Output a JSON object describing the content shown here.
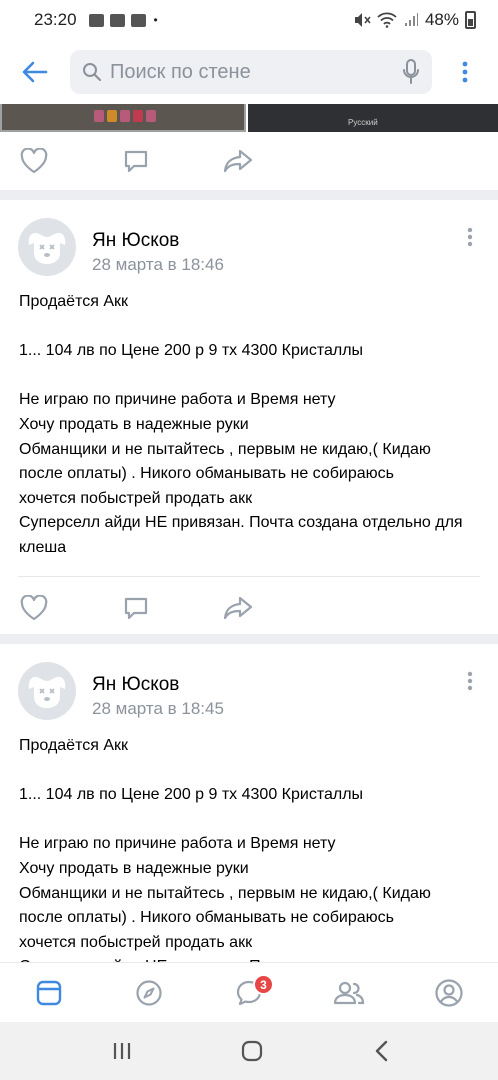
{
  "status_bar": {
    "time": "23:20",
    "dot": "•",
    "battery": "48%"
  },
  "search": {
    "placeholder": "Поиск по стене"
  },
  "prev_post": {
    "image_caption": "Русский"
  },
  "posts": [
    {
      "author": "Ян Юсков",
      "date": "28 марта в 18:46",
      "text": "Продаётся   Акк\n\n1... 104 лв по Цене 200 р 9 тх 4300 Кристаллы\n\nНе играю по причине работа и Время нету\nХочу продать в надежные руки\nОбманщики и не пытайтесь , первым не кидаю,( Кидаю после оплаты) . Никого обманывать не собираюсь\nхочется побыстрей продать акк\nСуперселл айди НЕ привязан. Почта создана отдельно для клеша"
    },
    {
      "author": "Ян Юсков",
      "date": "28 марта в 18:45",
      "text": "Продаётся   Акк\n\n1... 104 лв по Цене 200 р 9 тх 4300 Кристаллы\n\nНе играю по причине работа и Время нету\nХочу продать в надежные руки\nОбманщики и не пытайтесь , первым не кидаю,( Кидаю после оплаты) . Никого обманывать не собираюсь\nхочется побыстрей продать акк\nСуперселл айди НЕ привязан. Почта создана отдельно для клеша"
    }
  ],
  "tabbar": {
    "messages_badge": "3"
  },
  "colors": {
    "accent": "#3f8ae0",
    "icon_gray": "#99a2ad",
    "badge": "#e64646"
  }
}
